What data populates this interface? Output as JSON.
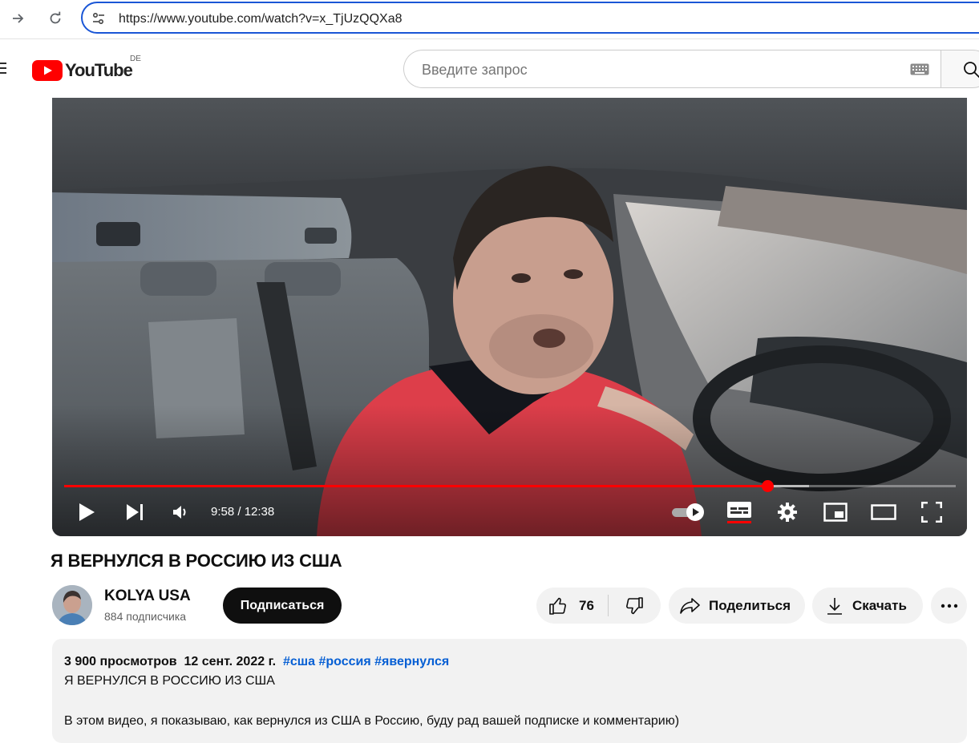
{
  "browser": {
    "url": "https://www.youtube.com/watch?v=x_TjUzQQXa8"
  },
  "header": {
    "logo_text": "YouTube",
    "region": "DE",
    "search_placeholder": "Введите запрос"
  },
  "player": {
    "current_time": "9:58",
    "duration": "12:38",
    "time_display": "9:58 / 12:38",
    "played_fraction": 0.789,
    "buffered_fraction": 0.835,
    "autoplay": true,
    "captions_on": true
  },
  "video": {
    "title": "Я ВЕРНУЛСЯ В РОССИЮ ИЗ США"
  },
  "channel": {
    "name": "KOLYA USA",
    "subscribers": "884 подписчика",
    "subscribe_label": "Подписаться"
  },
  "actions": {
    "like_count": "76",
    "share_label": "Поделиться",
    "download_label": "Скачать"
  },
  "description": {
    "views": "3 900 просмотров",
    "date": "12 сент. 2022 г.",
    "hashtags": [
      "#сша",
      "#россия",
      "#явернулся"
    ],
    "line1": "Я ВЕРНУЛСЯ В РОССИЮ ИЗ США",
    "line2": "В этом видео, я показываю, как вернулся из США в Россию, буду рад вашей подписке и комментарию)"
  },
  "colors": {
    "accent": "#ff0000",
    "link": "#065fd4",
    "address_focus": "#1a56d6"
  },
  "icons": [
    "forward-icon",
    "reload-icon",
    "site-settings-icon",
    "menu-icon",
    "youtube-logo-icon",
    "keyboard-icon",
    "search-icon",
    "play-icon",
    "next-icon",
    "volume-icon",
    "autoplay-toggle-icon",
    "subtitles-icon",
    "settings-icon",
    "miniplayer-icon",
    "theater-icon",
    "fullscreen-icon",
    "like-icon",
    "dislike-icon",
    "share-icon",
    "download-icon",
    "more-icon"
  ]
}
